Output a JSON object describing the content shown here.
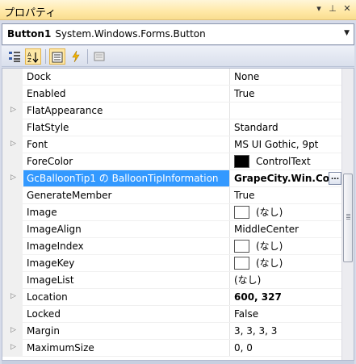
{
  "window": {
    "title": "プロパティ",
    "btn_dropdown": "▾",
    "btn_pin": "⊥",
    "btn_close": "✕"
  },
  "object_selector": {
    "name": "Button1",
    "type": "System.Windows.Forms.Button"
  },
  "toolbar": {
    "buttons": [
      "categorized",
      "alphabetical",
      "properties",
      "events",
      "property-pages"
    ],
    "active": "alphabetical"
  },
  "properties": [
    {
      "name": "Dock",
      "value": "None",
      "expandable": false
    },
    {
      "name": "Enabled",
      "value": "True",
      "expandable": false
    },
    {
      "name": "FlatAppearance",
      "value": "",
      "expandable": true
    },
    {
      "name": "FlatStyle",
      "value": "Standard",
      "expandable": false
    },
    {
      "name": "Font",
      "value": "MS UI Gothic, 9pt",
      "expandable": true
    },
    {
      "name": "ForeColor",
      "value": "ControlText",
      "expandable": false,
      "swatch": "#000000"
    },
    {
      "name": "GcBalloonTip1 の BalloonTipInformation",
      "value": "GrapeCity.Win.Com",
      "expandable": true,
      "selected": true,
      "bold": true,
      "ellipsis": "..."
    },
    {
      "name": "GenerateMember",
      "value": "True",
      "expandable": false
    },
    {
      "name": "Image",
      "value": "(なし)",
      "expandable": false,
      "swatch": "#ffffff"
    },
    {
      "name": "ImageAlign",
      "value": "MiddleCenter",
      "expandable": false
    },
    {
      "name": "ImageIndex",
      "value": "(なし)",
      "expandable": false,
      "swatch": "#ffffff"
    },
    {
      "name": "ImageKey",
      "value": "(なし)",
      "expandable": false,
      "swatch": "#ffffff"
    },
    {
      "name": "ImageList",
      "value": "(なし)",
      "expandable": false
    },
    {
      "name": "Location",
      "value": "600, 327",
      "expandable": true,
      "bold": true
    },
    {
      "name": "Locked",
      "value": "False",
      "expandable": false
    },
    {
      "name": "Margin",
      "value": "3, 3, 3, 3",
      "expandable": true
    },
    {
      "name": "MaximumSize",
      "value": "0, 0",
      "expandable": true
    }
  ],
  "colors": {
    "selection": "#3399ff",
    "title_gradient": "#ffe8a6",
    "gutter": "#f0f0f0"
  }
}
